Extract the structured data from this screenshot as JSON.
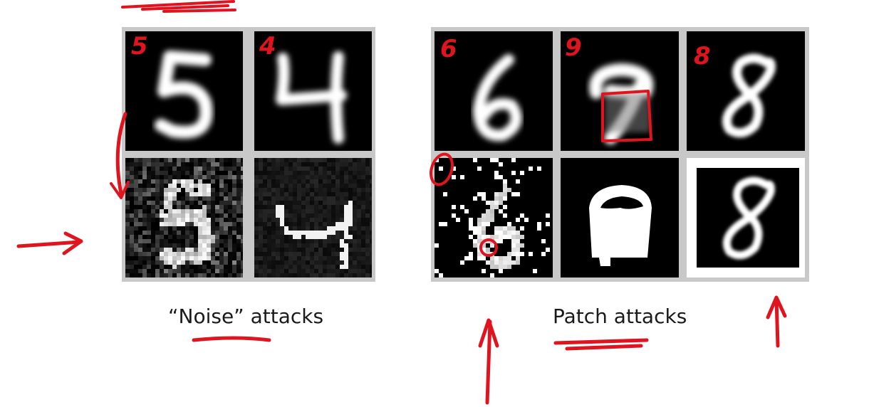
{
  "captions": {
    "noise": "“Noise” attacks",
    "patch": "Patch attacks"
  },
  "handwritten_labels": {
    "noise_digit_1": "5",
    "noise_digit_2": "4",
    "patch_digit_1": "6",
    "patch_digit_2": "9",
    "patch_digit_3": "8"
  },
  "colors": {
    "ink": "#e0141e",
    "panel_border": "#c8c8c8",
    "digit_background": "#000000",
    "digit_stroke": "#ffffff"
  }
}
